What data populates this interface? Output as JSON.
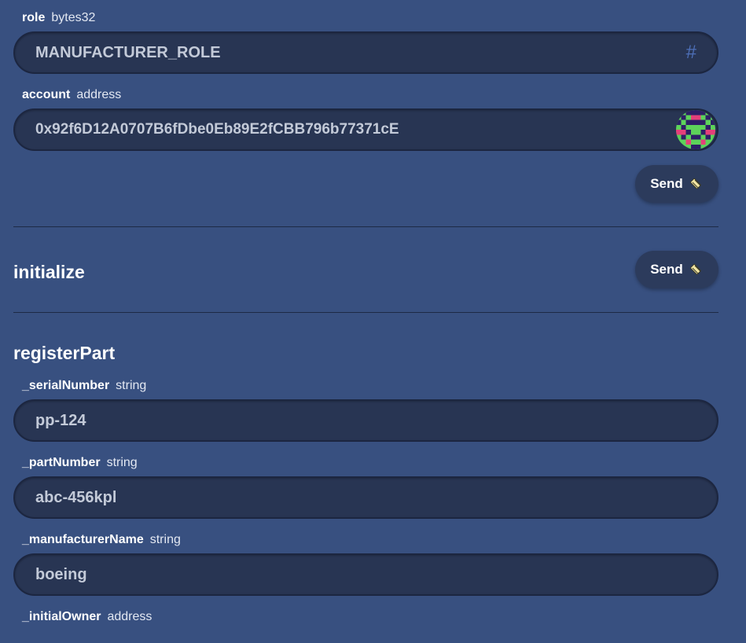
{
  "grantRole": {
    "params": [
      {
        "name": "role",
        "type": "bytes32",
        "value": "MANUFACTURER_ROLE",
        "icon": "hash-icon"
      },
      {
        "name": "account",
        "type": "address",
        "value": "0x92f6D12A0707B6fDbe0Eb89E2fCBB796b77371cE",
        "icon": "blockie-avatar-icon"
      }
    ],
    "send_label": "Send"
  },
  "initialize": {
    "title": "initialize",
    "send_label": "Send"
  },
  "registerPart": {
    "title": "registerPart",
    "params": [
      {
        "name": "_serialNumber",
        "type": "string",
        "value": "pp-124"
      },
      {
        "name": "_partNumber",
        "type": "string",
        "value": "abc-456kpl"
      },
      {
        "name": "_manufacturerName",
        "type": "string",
        "value": "boeing"
      },
      {
        "name": "_initialOwner",
        "type": "address"
      }
    ]
  },
  "colors": {
    "background": "#385080",
    "field_background": "#283553",
    "field_border": "#1c2640",
    "button_background": "#2c3b5c",
    "hash_icon": "#4d6fb8",
    "blockie_green": "#5dd35a",
    "blockie_purple": "#2d1f66",
    "blockie_pink": "#e4407a"
  }
}
